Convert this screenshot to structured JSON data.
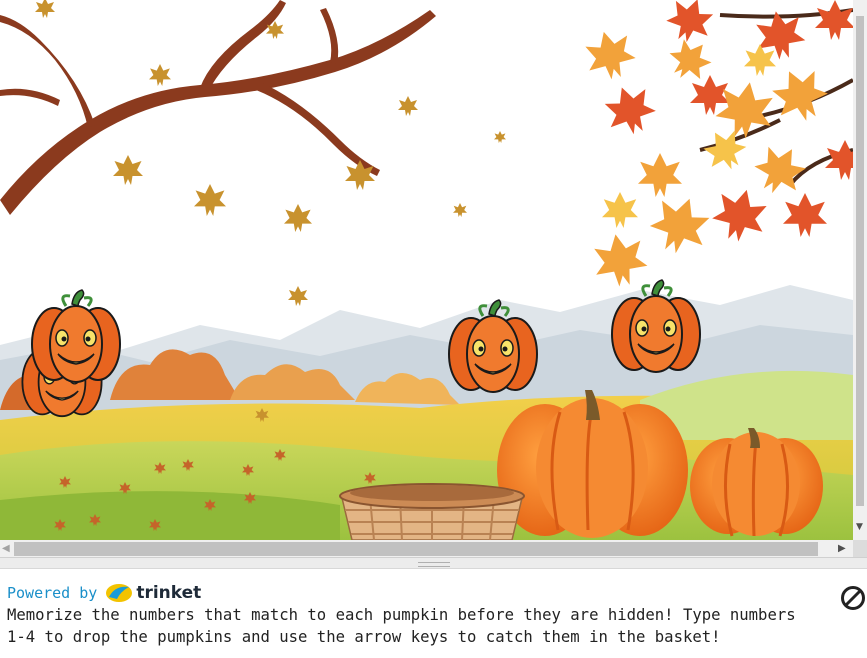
{
  "console": {
    "powered_by": "Powered by",
    "brand": "trinket",
    "output_line1": "Memorize the numbers that match to each pumpkin before they are hidden! Type numbers",
    "output_line2": "1-4 to drop the pumpkins and use the arrow keys to catch them in the basket!"
  },
  "icons": {
    "stop": "no-entry-icon",
    "scroll_left": "triangle-left-icon",
    "scroll_right": "triangle-right-icon",
    "scroll_down": "triangle-down-icon"
  },
  "colors": {
    "link_blue": "#1a8fc9",
    "pumpkin_orange": "#f06a2a",
    "sky": "#ffffff"
  }
}
